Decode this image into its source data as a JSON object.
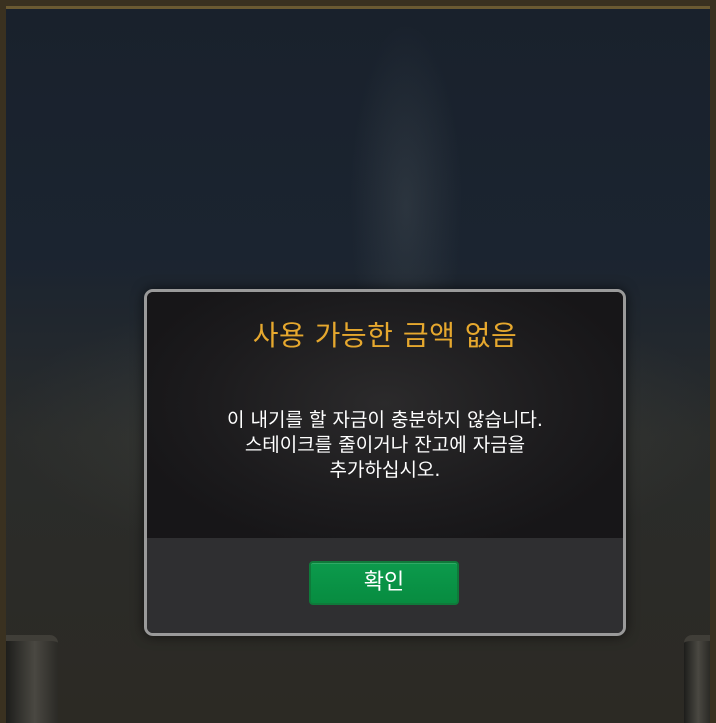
{
  "dialog": {
    "title": "사용 가능한 금액 없음",
    "message_lines": [
      "이 내기를 할 자금이 충분하지 않습니다.",
      "스테이크를 줄이거나 잔고에 자금을",
      "추가하십시오."
    ],
    "confirm_label": "확인"
  },
  "colors": {
    "title": "#e6a82e",
    "confirm_button": "#078c40",
    "dialog_border": "#9a9a9a"
  }
}
